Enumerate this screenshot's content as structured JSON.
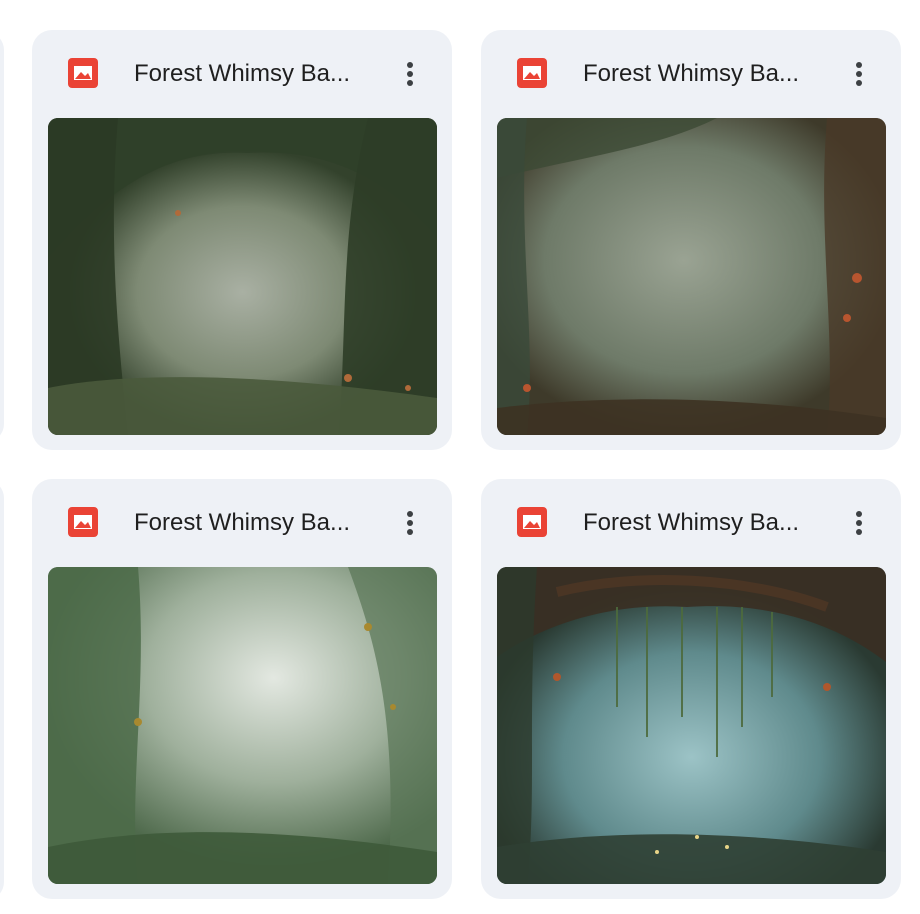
{
  "files": [
    {
      "title": "Forest Whimsy Ba...",
      "type_icon": "image-file-icon",
      "menu_icon": "more-vert-icon",
      "palette": [
        "#3b4a33",
        "#8f9887",
        "#2b3a25"
      ]
    },
    {
      "title": "Forest Whimsy Ba...",
      "type_icon": "image-file-icon",
      "menu_icon": "more-vert-icon",
      "palette": [
        "#4a5a48",
        "#8e9a88",
        "#5a4630"
      ]
    },
    {
      "title": "Forest Whimsy Ba...",
      "type_icon": "image-file-icon",
      "menu_icon": "more-vert-icon",
      "palette": [
        "#5f7a5f",
        "#d4dcd2",
        "#3f5a3c"
      ]
    },
    {
      "title": "Forest Whimsy Ba...",
      "type_icon": "image-file-icon",
      "menu_icon": "more-vert-icon",
      "palette": [
        "#2f3a2a",
        "#8fb4b8",
        "#6b4a30"
      ]
    }
  ],
  "colors": {
    "card_bg": "#eef1f6",
    "icon_red": "#ea4335",
    "title_text": "#1f1f1f"
  }
}
